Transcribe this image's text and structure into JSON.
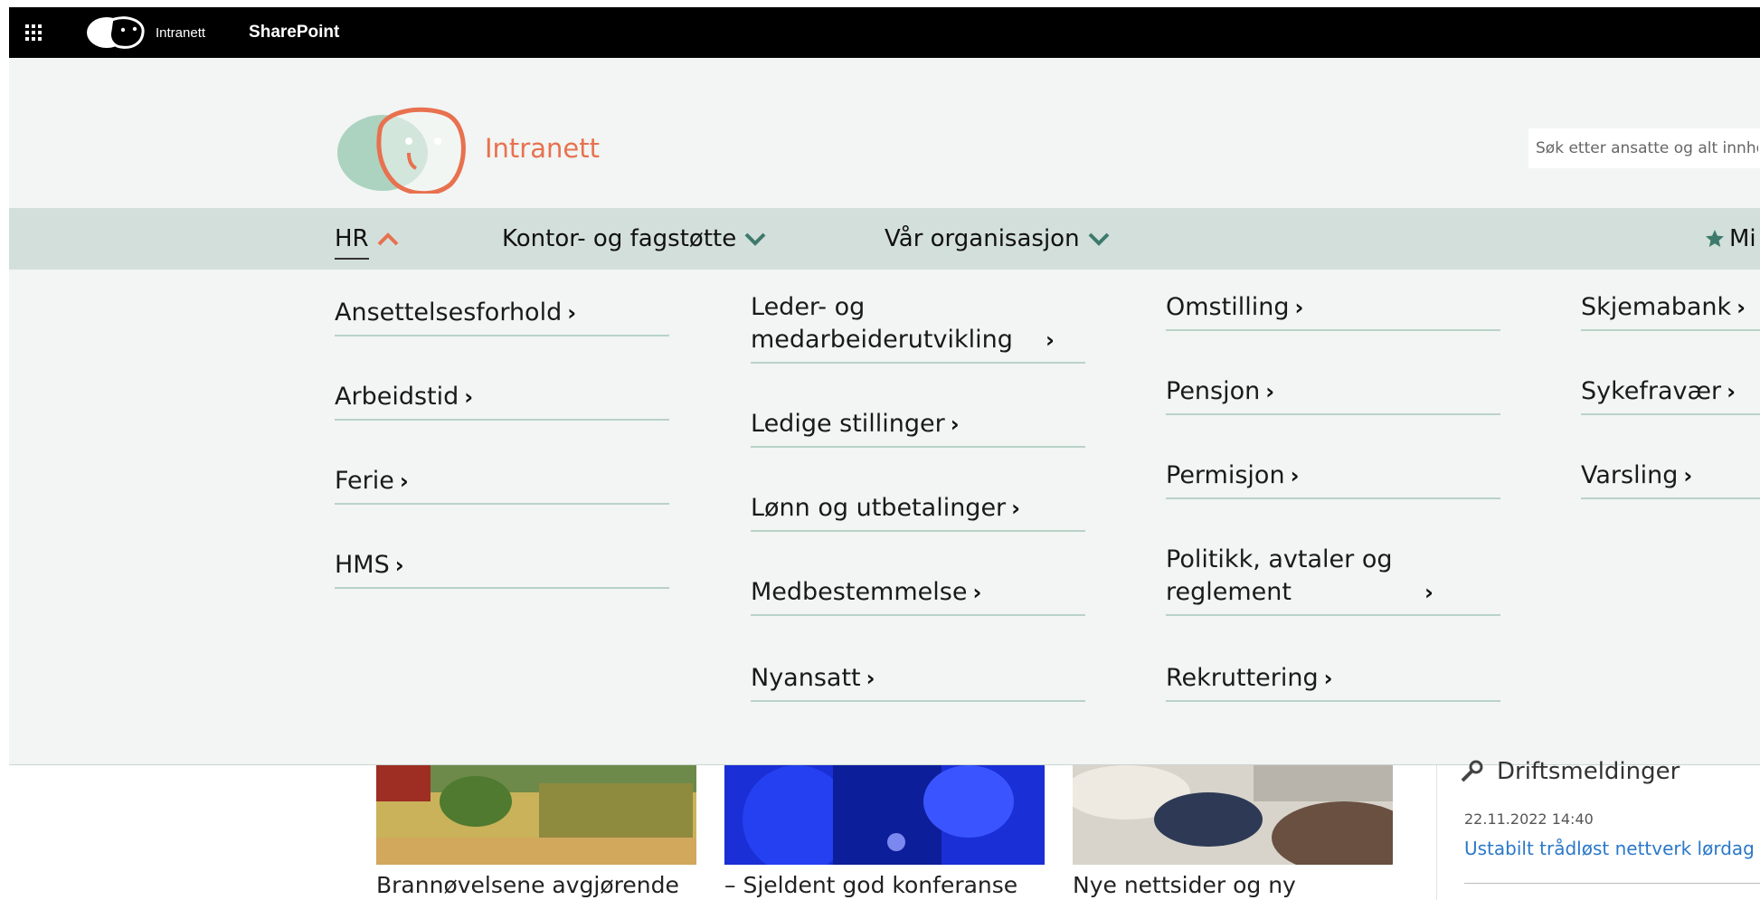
{
  "suite_bar": {
    "app_launcher_icon": "waffle-icon",
    "logo_text": "Intranett",
    "app_name": "SharePoint"
  },
  "header": {
    "site_title": "Intranett",
    "search_placeholder": "Søk etter ansatte og alt innhold"
  },
  "nav": {
    "items": [
      {
        "label": "HR",
        "state": "expanded",
        "chevron": "chevron-up-icon"
      },
      {
        "label": "Kontor- og fagstøtte",
        "state": "collapsed",
        "chevron": "chevron-down-icon"
      },
      {
        "label": "Vår organisasjon",
        "state": "collapsed",
        "chevron": "chevron-down-icon"
      },
      {
        "label": "Mi",
        "icon": "star-icon"
      }
    ]
  },
  "menu": {
    "columns": [
      {
        "items": [
          "Ansettelsesforhold",
          "Arbeidstid",
          "Ferie",
          "HMS"
        ]
      },
      {
        "items": [
          "Leder- og medarbeiderutvikling",
          "Ledige stillinger",
          "Lønn og utbetalinger",
          "Medbestemmelse",
          "Nyansatt"
        ]
      },
      {
        "items": [
          "Omstilling",
          "Pensjon",
          "Permisjon",
          "Politikk, avtaler og reglement",
          "Rekruttering"
        ]
      },
      {
        "items": [
          "Skjemabank",
          "Sykefravær",
          "Varsling"
        ]
      }
    ]
  },
  "news": {
    "cards": [
      {
        "title": "Brannøvelsene avgjørende"
      },
      {
        "title": "– Sjeldent god konferanse"
      },
      {
        "title": "Nye nettsider og ny"
      }
    ]
  },
  "driftsmeldinger": {
    "heading": "Driftsmeldinger",
    "date": "22.11.2022 14:40",
    "link": "Ustabilt trådløst nettverk lørdag"
  },
  "colors": {
    "accent": "#e8714f",
    "nav_bg": "#d3dfdb",
    "header_bg": "#f2f5f3",
    "chevron_green": "#3e7a6b",
    "link": "#2a78c8"
  }
}
